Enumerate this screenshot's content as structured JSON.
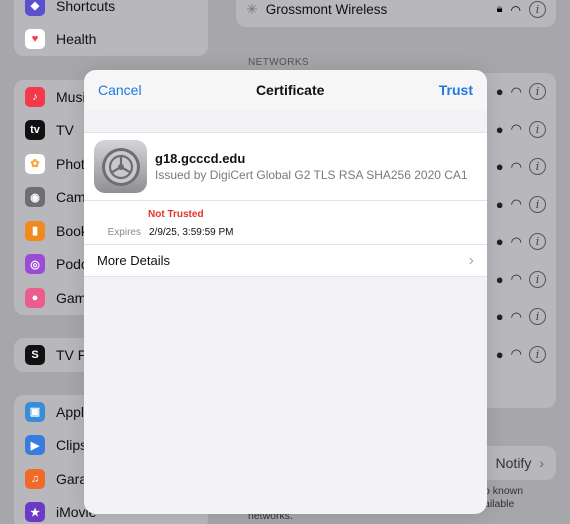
{
  "sidebar": {
    "top_items": [
      {
        "label": "Shortcuts",
        "icon": "shortcuts-icon",
        "color": "#5a4fcf"
      },
      {
        "label": "Health",
        "icon": "health-icon",
        "color": "#ffffff"
      }
    ],
    "media_items": [
      {
        "label": "Music",
        "icon": "music-icon",
        "color": "#f5384a"
      },
      {
        "label": "TV",
        "icon": "tv-icon",
        "color": "#111111"
      },
      {
        "label": "Photos",
        "icon": "photos-icon",
        "color": "#f4a53a"
      },
      {
        "label": "Camera",
        "icon": "camera-icon",
        "color": "#6e6e73"
      },
      {
        "label": "Books",
        "icon": "books-icon",
        "color": "#f08a1c"
      },
      {
        "label": "Podcasts",
        "icon": "podcasts-icon",
        "color": "#9b4cd6"
      },
      {
        "label": "Game Center",
        "icon": "game-center-icon",
        "color": "#ec5c8d"
      }
    ],
    "provider_items": [
      {
        "label": "TV Provider",
        "icon": "tv-provider-icon",
        "color": "#111111"
      }
    ],
    "app_items": [
      {
        "label": "Apple Configurator",
        "icon": "apple-configurator-icon",
        "color": "#3a8cd9"
      },
      {
        "label": "Clips",
        "icon": "clips-icon",
        "color": "#3a7be0"
      },
      {
        "label": "GarageBand",
        "icon": "garageband-icon",
        "color": "#f06a2a"
      },
      {
        "label": "iMovie",
        "icon": "imovie-icon",
        "color": "#6b3bc8"
      }
    ]
  },
  "networks": {
    "current_network": "Grossmont Wireless",
    "section_label": "NETWORKS",
    "notify_label": "Notify",
    "footnote_1": "o known",
    "footnote_2": "ailable",
    "footnote_3": "networks."
  },
  "modal": {
    "cancel_label": "Cancel",
    "title": "Certificate",
    "trust_label": "Trust",
    "cert_name": "g18.gcccd.edu",
    "issuer": "Issued by DigiCert Global G2 TLS RSA SHA256 2020 CA1",
    "status": "Not Trusted",
    "expires_label": "Expires",
    "expires_value": "2/9/25, 3:59:59 PM",
    "more_details_label": "More Details",
    "accent_color": "#1f7ae0",
    "status_color": "#e0342b"
  }
}
